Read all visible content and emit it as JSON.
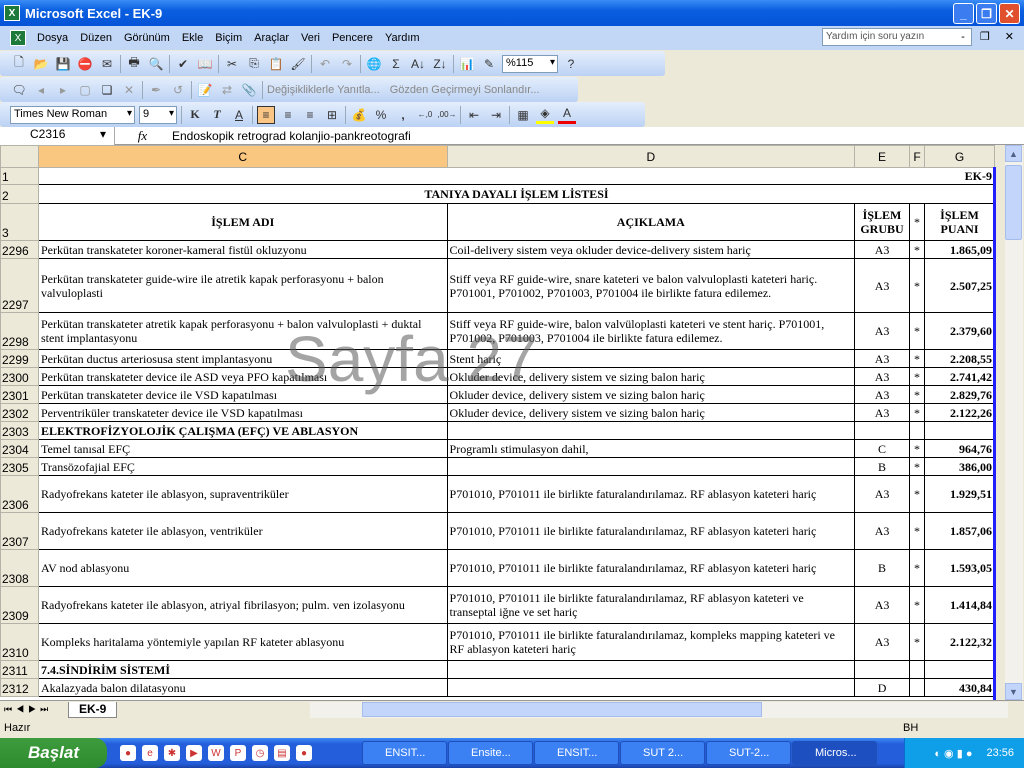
{
  "window": {
    "title": "Microsoft Excel - EK-9",
    "min": "_",
    "max": "❐",
    "close": "✕"
  },
  "menu": {
    "items": [
      "Dosya",
      "Düzen",
      "Görünüm",
      "Ekle",
      "Biçim",
      "Araçlar",
      "Veri",
      "Pencere",
      "Yardım"
    ],
    "help_placeholder": "Yardım için soru yazın"
  },
  "toolbar": {
    "zoom": "%115",
    "review_reply": "Değişikliklerle Yanıtla...",
    "review_end": "Gözden Geçirmeyi Sonlandır...",
    "font": "Times New Roman",
    "size": "9",
    "bold": "K",
    "italic": "T",
    "underline": "A",
    "percent": "%",
    "comma": ","
  },
  "formula": {
    "cell": "C2316",
    "fx": "fx",
    "value": "Endoskopik retrograd kolanjio-pankreotografi"
  },
  "columns": [
    "C",
    "D",
    "E",
    "F",
    "G"
  ],
  "header": {
    "r1": "1",
    "ek": "EK-9",
    "r2": "2",
    "title": "TANIYA DAYALI İŞLEM LİSTESİ",
    "r3": "3",
    "c": "İŞLEM ADI",
    "d": "AÇIKLAMA",
    "e": "İŞLEM GRUBU",
    "f": "*",
    "g": "İŞLEM PUANI"
  },
  "rows": [
    {
      "n": "2296",
      "c": "Perkütan transkateter koroner-kameral fistül okluzyonu",
      "d": "Coil-delivery sistem veya okluder device-delivery sistem hariç",
      "e": "A3",
      "f": "*",
      "g": "1.865,09"
    },
    {
      "n": "2297",
      "c": "Perkütan transkateter guide-wire ile atretik kapak perforasyonu + balon valvuloplasti",
      "d": "Stiff veya RF guide-wire, snare kateteri ve balon valvuloplasti kateteri hariç. P701001, P701002, P701003, P701004 ile birlikte fatura edilemez.",
      "e": "A3",
      "f": "*",
      "g": "2.507,25"
    },
    {
      "n": "2298",
      "c": "Perkütan transkateter atretik kapak perforasyonu +  balon valvuloplasti + duktal stent implantasyonu",
      "d": "Stiff veya RF guide-wire,  balon valvüloplasti kateteri ve stent hariç. P701001, P701002, P701003, P701004 ile birlikte fatura edilemez.",
      "e": "A3",
      "f": "*",
      "g": "2.379,60"
    },
    {
      "n": "2299",
      "c": "Perkütan ductus arteriosusa stent implantasyonu",
      "d": "Stent hariç",
      "e": "A3",
      "f": "*",
      "g": "2.208,55"
    },
    {
      "n": "2300",
      "c": "Perkütan transkateter device ile ASD veya PFO kapatılması",
      "d": "Okluder device, delivery sistem ve sizing balon hariç",
      "e": "A3",
      "f": "*",
      "g": "2.741,42"
    },
    {
      "n": "2301",
      "c": "Perkütan transkateter device ile VSD kapatılması",
      "d": "Okluder device, delivery sistem ve sizing balon hariç",
      "e": "A3",
      "f": "*",
      "g": "2.829,76"
    },
    {
      "n": "2302",
      "c": "Perventriküler transkateter device ile VSD kapatılması",
      "d": "Okluder device, delivery sistem ve sizing balon hariç",
      "e": "A3",
      "f": "*",
      "g": "2.122,26"
    },
    {
      "n": "2303",
      "c": "ELEKTROFİZYOLOJİK ÇALIŞMA (EFÇ) VE ABLASYON",
      "d": "",
      "e": "",
      "f": "",
      "g": "",
      "bold": true
    },
    {
      "n": "2304",
      "c": "Temel tanısal EFÇ",
      "d": "Programlı stimulasyon dahil,",
      "e": "C",
      "f": "*",
      "g": "964,76"
    },
    {
      "n": "2305",
      "c": "Transözofajial EFÇ",
      "d": "",
      "e": "B",
      "f": "*",
      "g": "386,00"
    },
    {
      "n": "2306",
      "c": "Radyofrekans kateter ile ablasyon, supraventriküler",
      "d": "P701010, P701011 ile birlikte faturalandırılamaz.  RF ablasyon kateteri hariç",
      "e": "A3",
      "f": "*",
      "g": "1.929,51"
    },
    {
      "n": "2307",
      "c": "Radyofrekans kateter ile ablasyon, ventriküler",
      "d": "P701010, P701011 ile birlikte faturalandırılamaz, RF ablasyon kateteri hariç",
      "e": "A3",
      "f": "*",
      "g": "1.857,06"
    },
    {
      "n": "2308",
      "c": "AV nod ablasyonu",
      "d": "P701010, P701011 ile birlikte faturalandırılamaz, RF ablasyon kateteri hariç",
      "e": "B",
      "f": "*",
      "g": "1.593,05"
    },
    {
      "n": "2309",
      "c": "Radyofrekans kateter ile ablasyon, atriyal fibrilasyon; pulm. ven izolasyonu",
      "d": "P701010, P701011 ile birlikte faturalandırılamaz, RF ablasyon kateteri ve  transeptal iğne ve set hariç",
      "e": "A3",
      "f": "*",
      "g": "1.414,84"
    },
    {
      "n": "2310",
      "c": "Kompleks haritalama yöntemiyle yapılan RF kateter ablasyonu",
      "d": "P701010, P701011 ile birlikte faturalandırılamaz, kompleks mapping kateteri  ve RF ablasyon kateteri hariç",
      "e": "A3",
      "f": "*",
      "g": "2.122,32"
    },
    {
      "n": "2311",
      "c": "7.4.SİNDİRİM SİSTEMİ",
      "d": "",
      "e": "",
      "f": "",
      "g": "",
      "bold": true
    },
    {
      "n": "2312",
      "c": "Akalazyada balon dilatasyonu",
      "d": "",
      "e": "D",
      "f": "",
      "g": "430,84"
    }
  ],
  "watermark": "Sayfa 27",
  "sheet": {
    "tab": "EK-9"
  },
  "status": {
    "ready": "Hazır",
    "mode": "BH"
  },
  "taskbar": {
    "start": "Başlat",
    "tasks": [
      "ENSIT...",
      "Ensite...",
      "ENSIT...",
      "SUT 2...",
      "SUT-2...",
      "Micros..."
    ],
    "clock": "23:56"
  }
}
